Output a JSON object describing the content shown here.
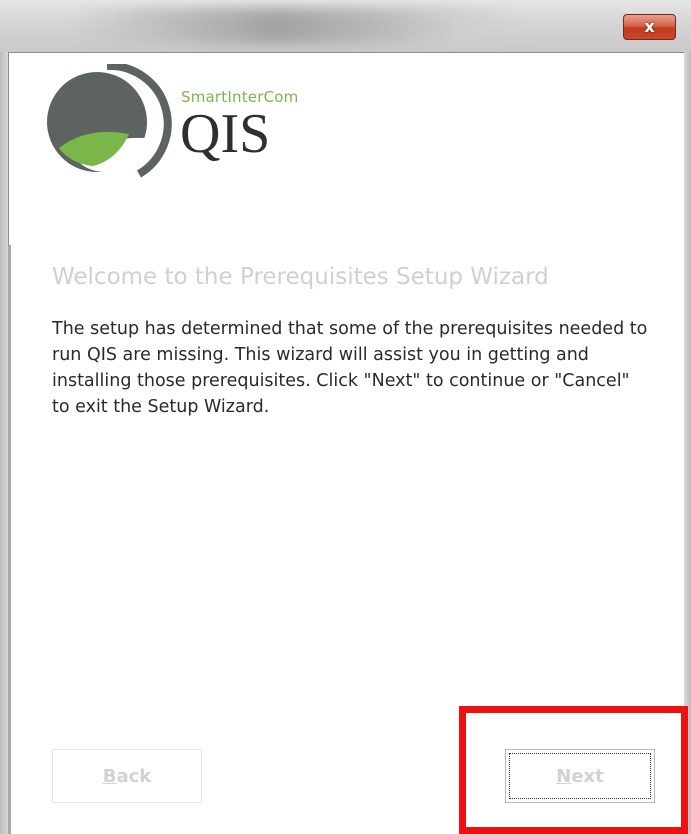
{
  "window": {
    "close_icon": "close-icon",
    "close_glyph": "x"
  },
  "brand": {
    "company": "SmartInterCom",
    "product": "QIS",
    "logo_icon": "smartintercom-logo",
    "colors": {
      "green": "#7ab648",
      "gray": "#5d6360",
      "text": "#2f2f2f"
    }
  },
  "wizard": {
    "heading": "Welcome to the Prerequisites Setup Wizard",
    "body": "The setup has determined that some of the prerequisites needed to run QIS are missing. This wizard will assist you in getting and installing those prerequisites. Click \"Next\" to continue or \"Cancel\" to exit the Setup Wizard."
  },
  "buttons": {
    "back": {
      "mnemonic": "B",
      "rest": "ack"
    },
    "next": {
      "mnemonic": "N",
      "rest": "ext"
    }
  },
  "annotation": {
    "highlight_color": "#ee1111"
  }
}
